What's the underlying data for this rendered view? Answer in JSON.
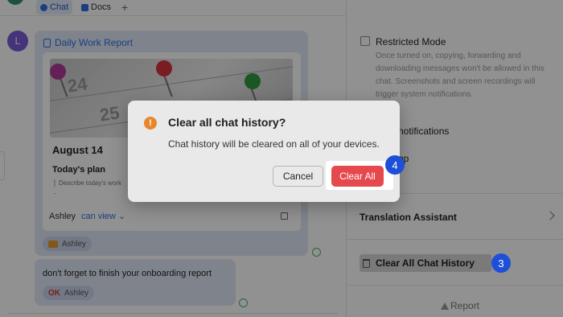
{
  "tabs": [
    {
      "label": "Chat",
      "icon": "chat-icon"
    },
    {
      "label": "Docs",
      "icon": "docs-icon"
    }
  ],
  "new_tab_symbol": "+",
  "chat": {
    "avatar_initial": "L",
    "doc_title": "Daily Work Report",
    "card": {
      "cal_numbers": [
        "24",
        "25"
      ],
      "date": "August 14",
      "plan_heading": "Today's plan",
      "plan_placeholder": "Describe today's work",
      "dash": "-",
      "owner": "Ashley",
      "permission": "can view ⌄"
    },
    "reaction_user": "Ashley",
    "message2": "don't forget to finish your onboarding report",
    "reaction2_label": "OK",
    "reaction2_user": "Ashley"
  },
  "settings": {
    "restricted_title": "Restricted Mode",
    "restricted_desc": "Once turned on, copying, forwarding and downloading messages won't be allowed in this chat. Screenshots and screen recordings will trigger system notifications.",
    "notifications_partial": "notifications",
    "top_partial": "op",
    "translation_label": "Translation Assistant",
    "clear_history_label": "Clear All Chat History",
    "report_label": "Report"
  },
  "dialog": {
    "icon": "!",
    "title": "Clear all chat history?",
    "body": "Chat history will be cleared on all of your devices.",
    "cancel_label": "Cancel",
    "confirm_label": "Clear All"
  },
  "steps": {
    "step3": "3",
    "step4": "4"
  },
  "colors": {
    "accent_blue": "#2f6fe0",
    "danger_red": "#e5484d",
    "warning_orange": "#e8862b",
    "step_badge_blue": "#1d4fd8"
  }
}
